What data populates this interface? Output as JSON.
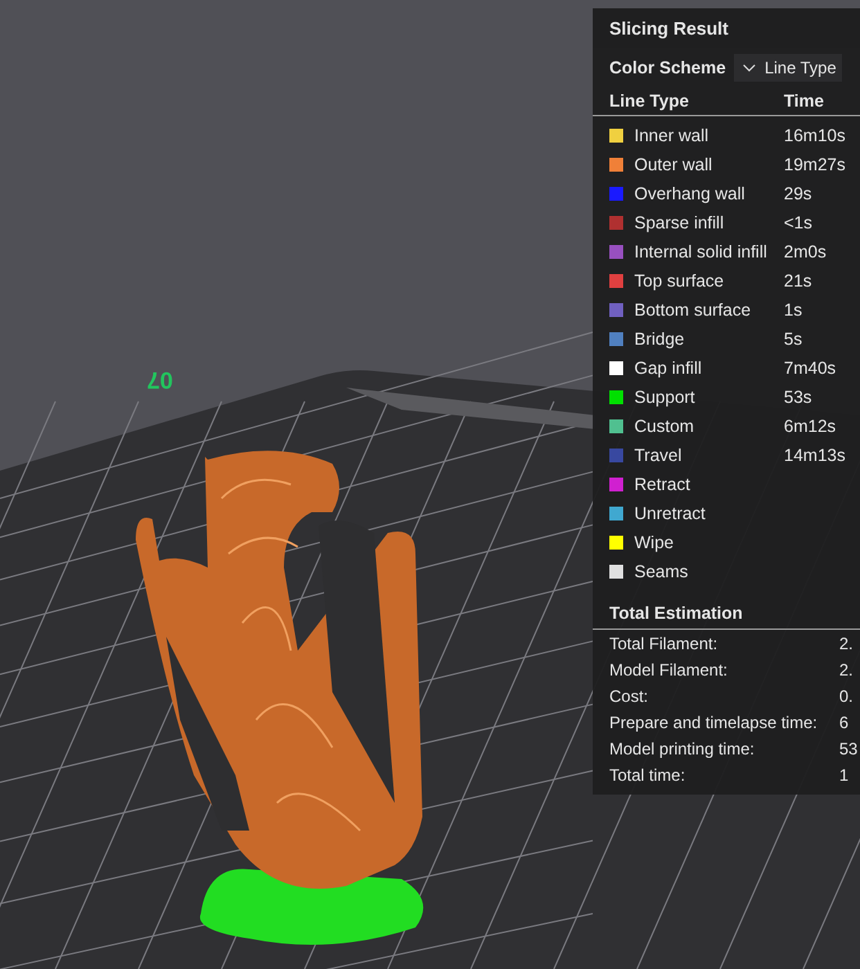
{
  "viewport": {
    "plate_label": "07"
  },
  "panel": {
    "title": "Slicing Result",
    "color_scheme": {
      "label": "Color Scheme",
      "value": "Line Type"
    },
    "columns": [
      "Line Type",
      "Time"
    ],
    "line_types": [
      {
        "name": "Inner wall",
        "time": "16m10s",
        "color": "#f0d040"
      },
      {
        "name": "Outer wall",
        "time": "19m27s",
        "color": "#f08038"
      },
      {
        "name": "Overhang wall",
        "time": "29s",
        "color": "#1a1aff"
      },
      {
        "name": "Sparse infill",
        "time": "<1s",
        "color": "#b03030"
      },
      {
        "name": "Internal solid infill",
        "time": "2m0s",
        "color": "#9850c0"
      },
      {
        "name": "Top surface",
        "time": "21s",
        "color": "#e04040"
      },
      {
        "name": "Bottom surface",
        "time": "1s",
        "color": "#7060c0"
      },
      {
        "name": "Bridge",
        "time": "5s",
        "color": "#5080c0"
      },
      {
        "name": "Gap infill",
        "time": "7m40s",
        "color": "#ffffff"
      },
      {
        "name": "Support",
        "time": "53s",
        "color": "#00e000"
      },
      {
        "name": "Custom",
        "time": "6m12s",
        "color": "#50c090"
      },
      {
        "name": "Travel",
        "time": "14m13s",
        "color": "#3848a0"
      },
      {
        "name": "Retract",
        "color": "#d020d0"
      },
      {
        "name": "Unretract",
        "color": "#40a8d0"
      },
      {
        "name": "Wipe",
        "color": "#ffff00"
      },
      {
        "name": "Seams",
        "color": "#e0e0e0"
      }
    ],
    "estimation": {
      "title": "Total Estimation",
      "rows": [
        {
          "label": "Total Filament:",
          "value": "2."
        },
        {
          "label": "Model Filament:",
          "value": "2."
        },
        {
          "label": "Cost:",
          "value": "0."
        },
        {
          "label": "Prepare and timelapse time:",
          "value": "6"
        },
        {
          "label": "Model printing time:",
          "value": "53"
        },
        {
          "label": "Total time:",
          "value": "1"
        }
      ]
    }
  }
}
